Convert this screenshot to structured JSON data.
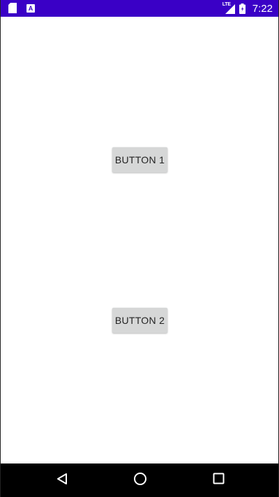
{
  "status_bar": {
    "background": "#3a00c6",
    "left_icons": [
      "sd-card-icon",
      "a-notification-icon"
    ],
    "a_icon_letter": "A",
    "network_label": "LTE",
    "time": "7:22"
  },
  "main": {
    "button_1_label": "BUTTON 1",
    "button_2_label": "BUTTON 2",
    "button_color": "#d6d7d7"
  },
  "nav_bar": {
    "background": "#000000",
    "items": [
      "back-icon",
      "home-icon",
      "recents-icon"
    ]
  }
}
